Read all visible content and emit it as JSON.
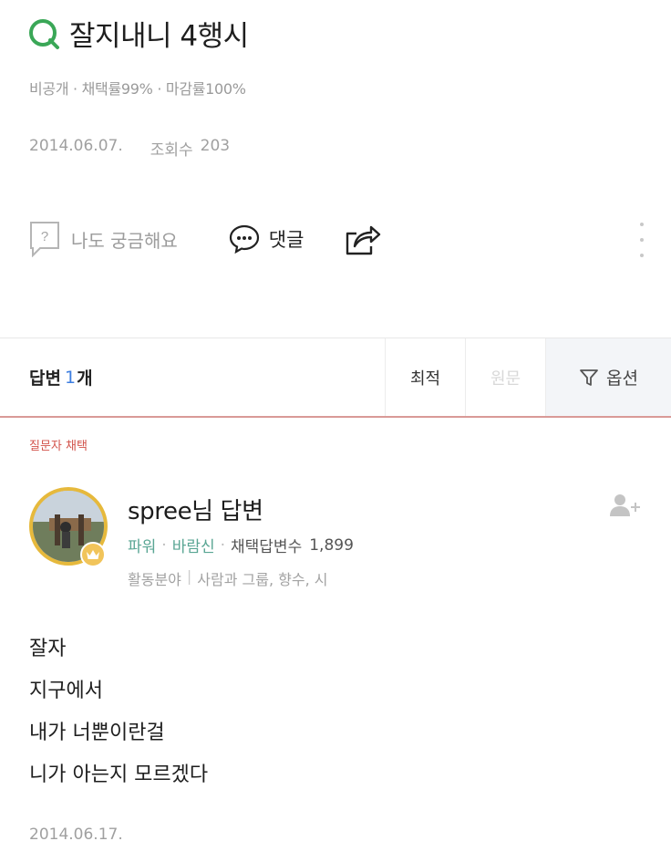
{
  "question": {
    "title": "잘지내니 4행시",
    "meta": "비공개 · 채택률99% · 마감률100%",
    "date": "2014.06.07.",
    "views_label": "조회수",
    "views": "203"
  },
  "actions": {
    "curious_label": "나도 궁금해요",
    "comment_label": "댓글"
  },
  "answers": {
    "label": "답변",
    "count": "1",
    "unit": "개",
    "sort_best": "최적",
    "sort_original": "원문",
    "options_label": "옵션"
  },
  "answer": {
    "selected_label": "질문자 채택",
    "author": "spree님 답변",
    "grade": "파워",
    "title": "바람신",
    "adopt_label": "채택답변수",
    "adopt_count": "1,899",
    "field_label": "활동분야",
    "fields": "사람과 그룹, 향수, 시",
    "lines": [
      "잘자",
      "지구에서",
      "내가 너뿐이란걸",
      "니가 아는지 모르겠다"
    ],
    "date": "2014.06.17."
  },
  "colors": {
    "q_icon": "#3aa757",
    "accent_blue": "#3d7ee0",
    "selected_red": "#d2524a",
    "grade_green": "#5aa694",
    "avatar_ring": "#e6b93c"
  }
}
